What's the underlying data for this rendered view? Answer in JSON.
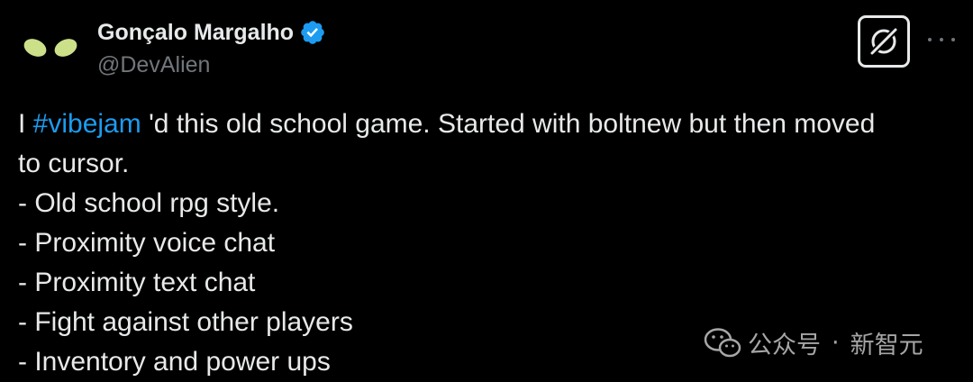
{
  "author": {
    "name": "Gonçalo Margalho",
    "handle": "@DevAlien",
    "verified": true,
    "avatar_icon": "alien-eyes-icon"
  },
  "toolbar": {
    "grok_icon": "grok-icon",
    "more_icon": "more-options-icon"
  },
  "tweet": {
    "line1_prefix": "I ",
    "hashtag": "#vibejam",
    "line1_suffix": " 'd this old school game. Started with boltnew but then moved",
    "line2": "to cursor.",
    "bullets": [
      "- Old school rpg style.",
      "- Proximity voice chat",
      "- Proximity text chat",
      "- Fight against other players",
      "- Inventory and power ups"
    ]
  },
  "watermark": {
    "icon": "wechat-icon",
    "label_left": "公众号",
    "separator": "·",
    "label_right": "新智元"
  },
  "colors": {
    "background": "#000000",
    "text": "#e7e9ea",
    "secondary": "#71767b",
    "hashtag": "#1d9bf0",
    "verified": "#1d9bf0",
    "avatar_eyes": "#cce08a"
  }
}
